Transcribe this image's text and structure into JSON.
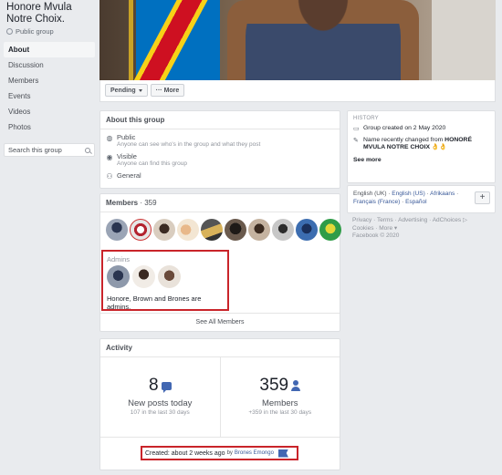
{
  "group": {
    "title": "Honore Mvula Notre Choix.",
    "type": "Public group"
  },
  "nav": {
    "items": [
      "About",
      "Discussion",
      "Members",
      "Events",
      "Videos",
      "Photos"
    ],
    "search_placeholder": "Search this group"
  },
  "actions": {
    "pending_label": "Pending",
    "more_label": "··· More"
  },
  "about": {
    "title": "About this group",
    "privacy_title": "Public",
    "privacy_desc": "Anyone can see who's in the group and what they post",
    "visibility_title": "Visible",
    "visibility_desc": "Anyone can find this group",
    "category": "General"
  },
  "members": {
    "title": "Members",
    "count": " · 359",
    "admins_label": "Admins",
    "admins_text": "Honore, Brown and Brones are admins.",
    "see_all": "See All Members"
  },
  "activity": {
    "title": "Activity",
    "posts_count": "8",
    "posts_label": "New posts today",
    "posts_sub": "107 in the last 30 days",
    "members_count": "359",
    "members_label": "Members",
    "members_sub": "+359 in the last 30 days",
    "created_label": "Created: about 2 weeks ago",
    "created_by": "by",
    "creator": "Brones Emongo"
  },
  "history": {
    "title": "HISTORY",
    "created_text": "Group created on 2 May 2020",
    "name_change_prefix": "Name recently changed from ",
    "name_change_old": "HONORÉ MVULA NOTRE CHOIX",
    "name_change_emoji": "👌👌",
    "see_more": "See more"
  },
  "languages": {
    "current": "English (UK)",
    "sep": " · ",
    "others": [
      "English (US)",
      "Afrikaans",
      "Français (France)",
      "Español"
    ],
    "add": "+"
  },
  "footer": {
    "links": [
      "Privacy",
      "Terms",
      "Advertising",
      "AdChoices",
      "Cookies",
      "More"
    ],
    "copyright": "Facebook © 2020"
  },
  "colors": {
    "accent": "#4267b2",
    "highlight_border": "#c9242a",
    "background": "#e9ebee"
  }
}
